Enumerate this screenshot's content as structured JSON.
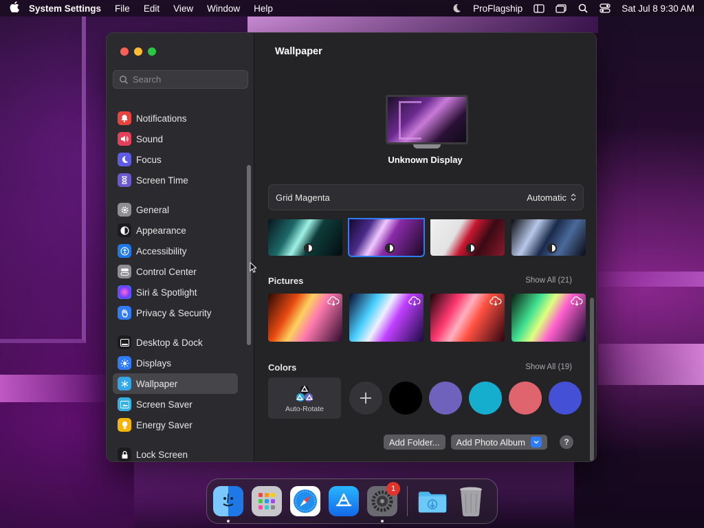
{
  "menubar": {
    "app_name": "System Settings",
    "menus": [
      "File",
      "Edit",
      "View",
      "Window",
      "Help"
    ],
    "user": "ProFlagship",
    "datetime": "Sat Jul 8  9:30 AM"
  },
  "sidebar": {
    "search_placeholder": "Search",
    "items": [
      {
        "label": "Notifications",
        "icon": "bell-icon",
        "color": "#e5453e"
      },
      {
        "label": "Sound",
        "icon": "speaker-icon",
        "color": "#e5405a"
      },
      {
        "label": "Focus",
        "icon": "moon-icon",
        "color": "#5e5ce6"
      },
      {
        "label": "Screen Time",
        "icon": "hourglass-icon",
        "color": "#6a5acd"
      },
      {
        "label": "General",
        "icon": "gear-icon",
        "color": "#8e8e93"
      },
      {
        "label": "Appearance",
        "icon": "appearance-icon",
        "color": "#1c1c1e"
      },
      {
        "label": "Accessibility",
        "icon": "accessibility-icon",
        "color": "#1f7ae8"
      },
      {
        "label": "Control Center",
        "icon": "control-center-icon",
        "color": "#8e8e93"
      },
      {
        "label": "Siri & Spotlight",
        "icon": "siri-icon",
        "color": "#b04ad8"
      },
      {
        "label": "Privacy & Security",
        "icon": "hand-icon",
        "color": "#2f7cf6"
      },
      {
        "label": "Desktop & Dock",
        "icon": "dock-icon",
        "color": "#1c1c1e"
      },
      {
        "label": "Displays",
        "icon": "sun-icon",
        "color": "#2f7cf6"
      },
      {
        "label": "Wallpaper",
        "icon": "snowflake-icon",
        "color": "#35a7e8"
      },
      {
        "label": "Screen Saver",
        "icon": "screen-saver-icon",
        "color": "#38b0e0"
      },
      {
        "label": "Energy Saver",
        "icon": "bulb-icon",
        "color": "#f5b40a"
      },
      {
        "label": "Lock Screen",
        "icon": "lock-icon",
        "color": "#1c1c1e"
      }
    ],
    "selected": "Wallpaper"
  },
  "main": {
    "title": "Wallpaper",
    "display_name": "Unknown Display",
    "current_wallpaper": "Grid Magenta",
    "mode": "Automatic",
    "sections": {
      "pictures": {
        "title": "Pictures",
        "show_all": "Show All (21)"
      },
      "colors": {
        "title": "Colors",
        "show_all": "Show All (19)"
      }
    },
    "auto_rotate_label": "Auto-Rotate",
    "color_swatches": [
      "#000000",
      "#6e62bd",
      "#16aece",
      "#e0646e",
      "#4451d6"
    ],
    "buttons": {
      "add_folder": "Add Folder...",
      "add_photo_album": "Add Photo Album",
      "help": "?"
    }
  },
  "dock": {
    "apps": [
      "finder-icon",
      "launchpad-icon",
      "safari-icon",
      "app-store-icon",
      "system-settings-icon"
    ],
    "settings_badge": "1",
    "right": [
      "downloads-folder-icon",
      "trash-icon"
    ]
  }
}
